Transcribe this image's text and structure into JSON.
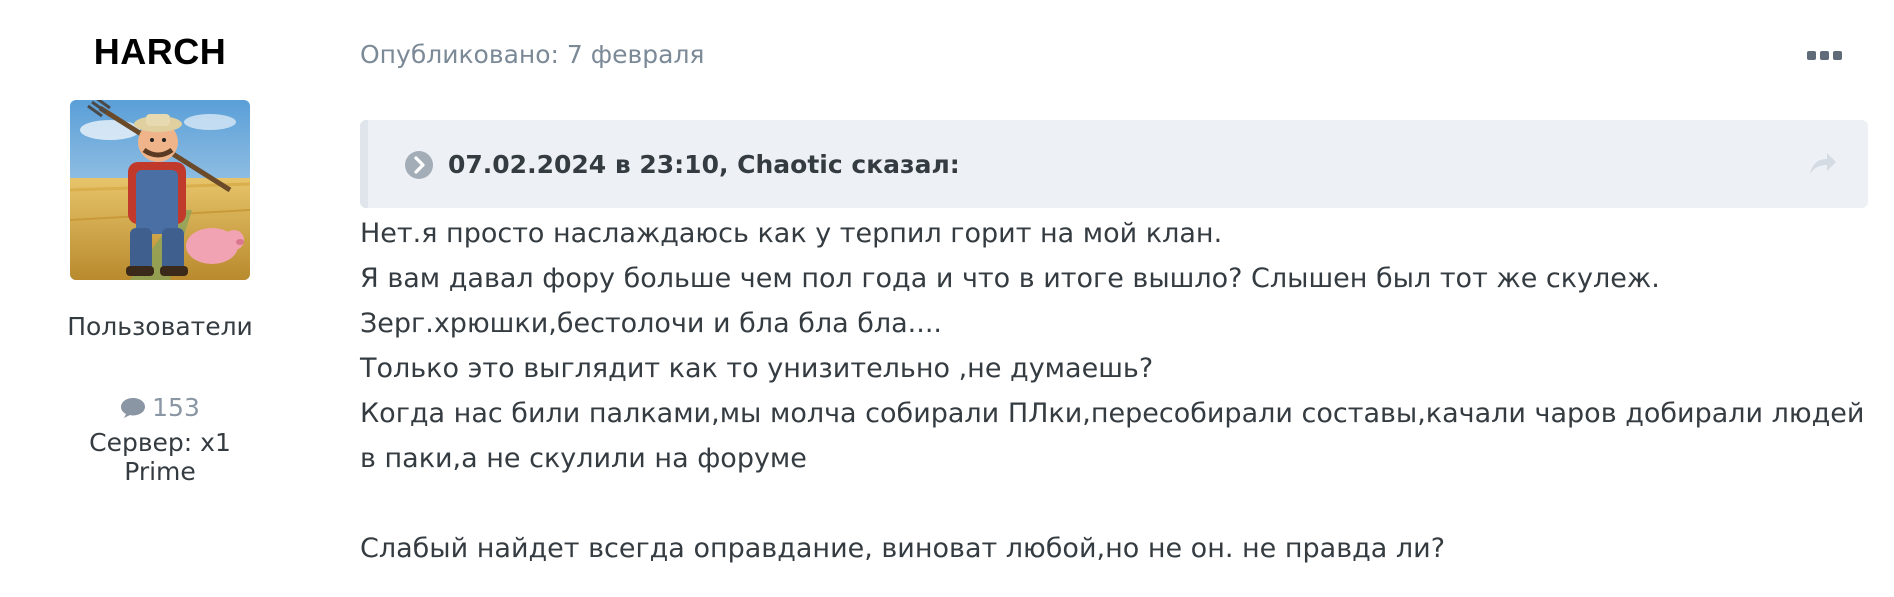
{
  "author": {
    "name": "HARCH",
    "group": "Пользователи",
    "post_count": "153",
    "server": "Сервер: x1 Prime",
    "icons": {
      "avatar": "farmer-avatar",
      "posts": "comment-icon"
    }
  },
  "post": {
    "meta": "Опубликовано: 7 февраля",
    "more_icon": "ellipsis-icon",
    "quote": {
      "citation": "07.02.2024 в 23:10, Chaotic сказал:",
      "toggle_icon": "chevron-circle-right-icon",
      "share_icon": "share-arrow-icon"
    },
    "lines": [
      "Нет.я просто наслаждаюсь как у терпил горит на мой клан.",
      "Я вам давал фору больше чем пол года и что в итоге вышло? Слышен был тот же скулеж.",
      "Зерг.хрюшки,бестолочи и бла бла бла....",
      "Только это выглядит как то унизительно ,не думаешь?",
      "Когда нас били палками,мы молча собирали ПЛки,пересобирали составы,качали чаров добирали людей в паки,а не скулили на форуме",
      "",
      "Слабый найдет всегда оправдание, виноват любой,но не он. не правда ли?"
    ]
  },
  "colors": {
    "text": "#353c41",
    "muted": "#7c8a98",
    "quote_bg": "#edf1f5",
    "icon_grey": "#8a96a3"
  }
}
